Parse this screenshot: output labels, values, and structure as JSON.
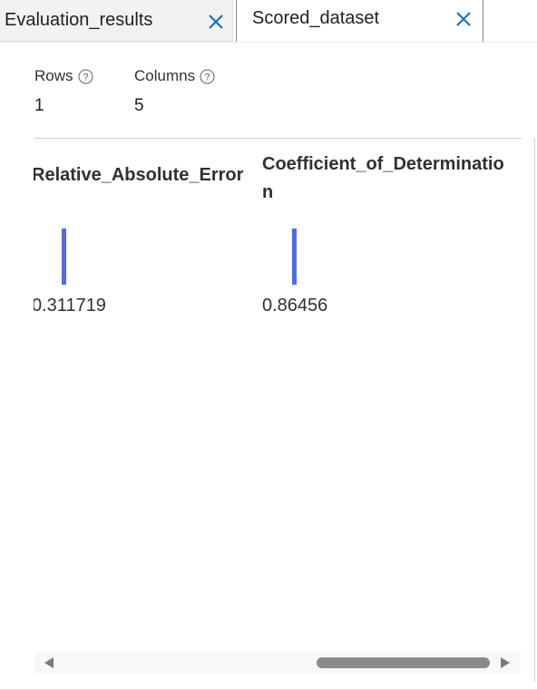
{
  "tabs": [
    {
      "label": "Evaluation_results",
      "active": false
    },
    {
      "label": "Scored_dataset",
      "active": true
    }
  ],
  "icons": {
    "close": "close-icon",
    "help": "help-circle-icon"
  },
  "summary": {
    "rows_label": "Rows",
    "rows_value": "1",
    "columns_label": "Columns",
    "columns_value": "5"
  },
  "columns": [
    {
      "header": "Relative_Absolute_Error",
      "value": "0.311719"
    },
    {
      "header": "Coefficient_of_Determination",
      "value": "0.86456"
    }
  ],
  "colors": {
    "accent": "#4f6bed",
    "close_icon": "#0f6cbd"
  }
}
